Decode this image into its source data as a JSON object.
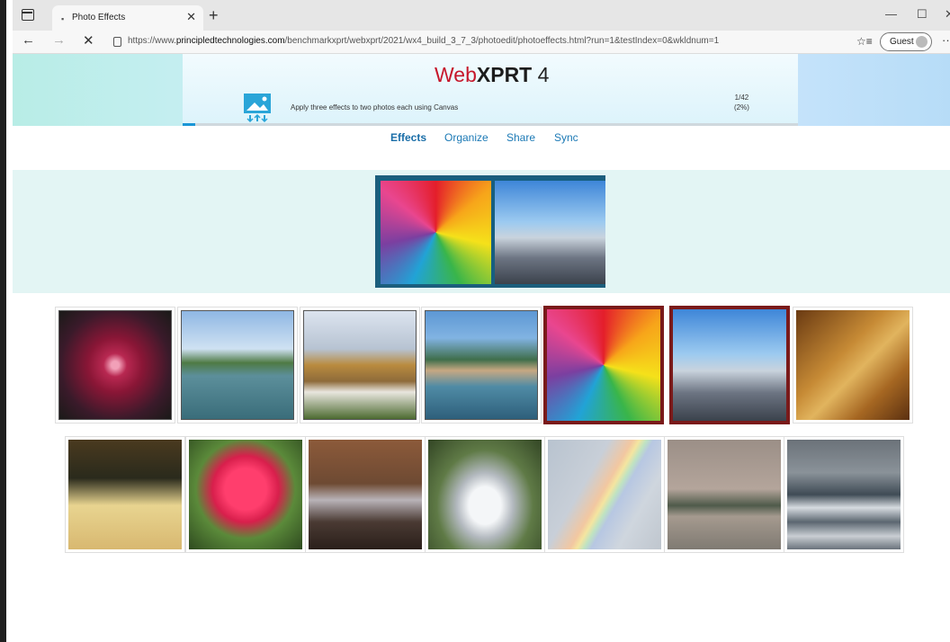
{
  "browser": {
    "tab_title": "Photo Effects",
    "tab_favicon": "▪",
    "url_prefix": "https://www.",
    "url_host": "principledtechnologies.com",
    "url_path": "/benchmarkxprt/webxprt/2021/wx4_build_3_7_3/photoedit/photoeffects.html?run=1&testIndex=0&wkldnum=1",
    "profile_label": "Guest"
  },
  "header": {
    "brand_web": "Web",
    "brand_xprt": "XPRT",
    "brand_version": " 4",
    "task_text": "Apply three effects to two photos each using Canvas",
    "progress_count": "1/42",
    "progress_percent_text": "(2%)",
    "progress_fraction": 0.02
  },
  "subnav": {
    "effects": "Effects",
    "organize": "Organize",
    "share": "Share",
    "sync": "Sync"
  },
  "gallery": {
    "row1": [
      "coleus-leaf",
      "paddle-boats",
      "thai-temple",
      "alpine-lake",
      "umbrellas",
      "city-skyline",
      "wooden-roof"
    ],
    "row2": [
      "gable-roof",
      "red-rose",
      "bench",
      "fountain",
      "rainbow",
      "beach-water-tower",
      "ocean-waves"
    ],
    "selected": [
      "umbrellas",
      "city-skyline"
    ]
  }
}
